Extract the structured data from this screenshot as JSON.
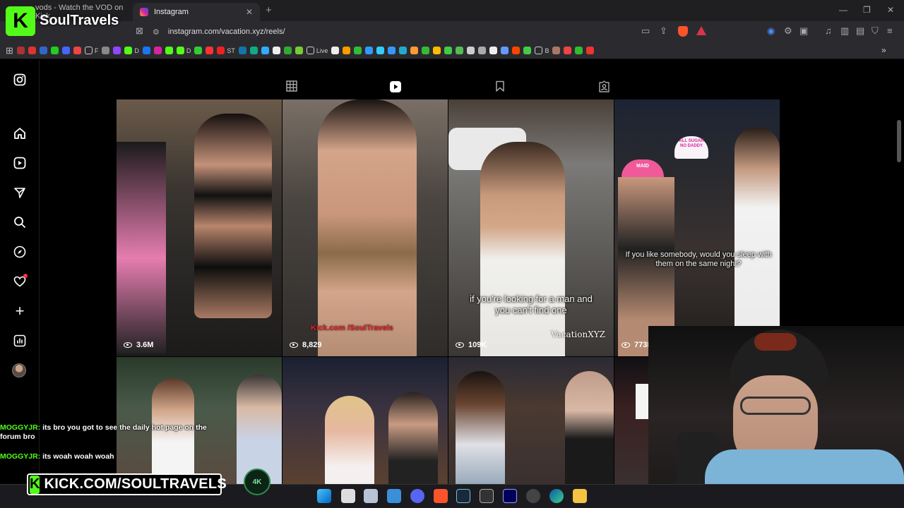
{
  "stream": {
    "channel_name": "SoulTravels",
    "banner_text": "KICK.COM/SOULTRAVELS",
    "kick_letter": "K",
    "badge": "4K",
    "watermark": "Kick.com /SoulTravels",
    "chat": [
      {
        "user": "MOGGYJR:",
        "message": " its bro you got to see the daily hot page on the forum bro"
      },
      {
        "user": "MOGGYJR:",
        "message": " its woah woah woah"
      }
    ]
  },
  "browser": {
    "tabs": [
      {
        "label": "vods - Watch the VOD on Kick"
      },
      {
        "label": "Instagram"
      }
    ],
    "url": "instagram.com/vacation.xyz/reels/",
    "bookmarks": [
      "F",
      "D",
      "D",
      "ST",
      "Live",
      "B"
    ]
  },
  "instagram": {
    "profile_tabs": [
      "grid-icon",
      "reels-icon",
      "saved-icon",
      "tagged-icon"
    ],
    "sidebar_icons": [
      "instagram-icon",
      "home-icon",
      "reels-icon",
      "messages-icon",
      "search-icon",
      "explore-icon",
      "notifications-icon",
      "create-icon",
      "dashboard-icon"
    ],
    "reels": [
      {
        "views": "3.6M"
      },
      {
        "views": "8,829"
      },
      {
        "views": "109K",
        "caption": "if you're looking for a man and you can't find one",
        "watermark": "VacationXYZ"
      },
      {
        "views": "773K",
        "caption": "If you like somebody, would you sleep with them on the same night?",
        "hat_text_1": "ALL SUGAR NO DADDY",
        "hat_text_2": "MAID"
      },
      {},
      {},
      {},
      {}
    ]
  },
  "colors": {
    "kick_green": "#53fc18",
    "ig_bg": "#000000",
    "chrome_bg": "#2b2b2f"
  }
}
